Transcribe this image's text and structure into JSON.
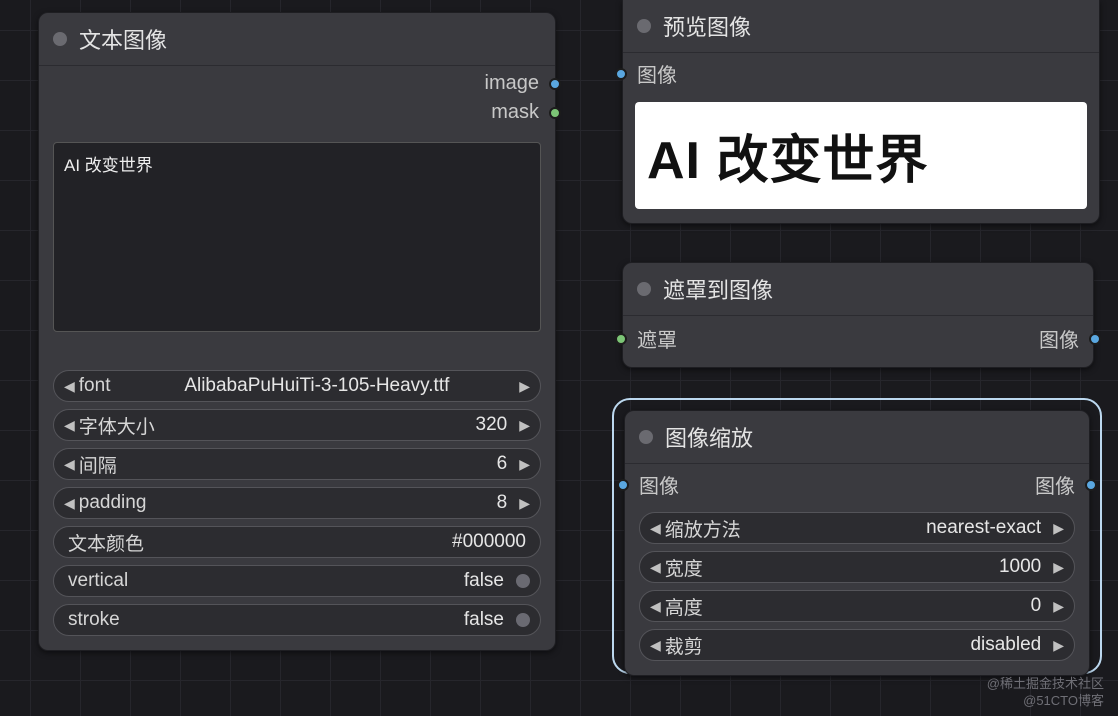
{
  "nodes": {
    "text_image": {
      "title": "文本图像",
      "outputs": {
        "image": "image",
        "mask": "mask"
      },
      "text_value": "AI 改变世界",
      "widgets": {
        "font": {
          "label": "font",
          "value": "AlibabaPuHuiTi-3-105-Heavy.ttf"
        },
        "size": {
          "label": "字体大小",
          "value": "320"
        },
        "gap": {
          "label": "间隔",
          "value": "6"
        },
        "padding": {
          "label": "padding",
          "value": "8"
        },
        "color": {
          "label": "文本颜色",
          "value": "#000000"
        },
        "vertical": {
          "label": "vertical",
          "value": "false"
        },
        "stroke": {
          "label": "stroke",
          "value": "false"
        }
      }
    },
    "preview": {
      "title": "预览图像",
      "input_label": "图像",
      "rendered_text": "AI 改变世界"
    },
    "mask_to_image": {
      "title": "遮罩到图像",
      "input_label": "遮罩",
      "output_label": "图像"
    },
    "image_scale": {
      "title": "图像缩放",
      "input_label": "图像",
      "output_label": "图像",
      "widgets": {
        "method": {
          "label": "缩放方法",
          "value": "nearest-exact"
        },
        "width": {
          "label": "宽度",
          "value": "1000"
        },
        "height": {
          "label": "高度",
          "value": "0"
        },
        "crop": {
          "label": "裁剪",
          "value": "disabled"
        }
      }
    }
  },
  "watermark": {
    "line1": "@稀土掘金技术社区",
    "line2": "@51CTO博客"
  }
}
